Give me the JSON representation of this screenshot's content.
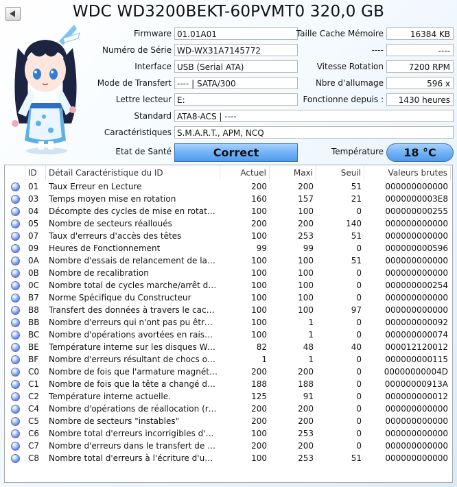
{
  "title": "WDC WD3200BEKT-60PVMT0 320,0 GB",
  "fields": {
    "firmware": {
      "label": "Firmware",
      "value": "01.01A01"
    },
    "serial": {
      "label": "Numéro de Série",
      "value": "WD-WX31A7145772"
    },
    "interface": {
      "label": "Interface",
      "value": "USB (Serial ATA)"
    },
    "transfer": {
      "label": "Mode de Transfert",
      "value": "---- | SATA/300"
    },
    "drive": {
      "label": "Lettre lecteur",
      "value": "E:"
    },
    "standard": {
      "label": "Standard",
      "value": "ATA8-ACS | ----"
    },
    "features": {
      "label": "Caractéristiques",
      "value": "S.M.A.R.T., APM, NCQ"
    },
    "cache": {
      "label": "Taille Cache Mémoire",
      "value": "16384 KB"
    },
    "blank": {
      "label": "----",
      "value": "----"
    },
    "rotation": {
      "label": "Vitesse Rotation",
      "value": "7200 RPM"
    },
    "power_count": {
      "label": "Nbre d'allumage",
      "value": "596 x"
    },
    "power_hours": {
      "label": "Fonctionne depuis :",
      "value": "1430 heures"
    }
  },
  "health": {
    "label": "Etat de Santé",
    "value": "Correct"
  },
  "temperature": {
    "label": "Température",
    "value": "18 °C"
  },
  "table": {
    "headers": {
      "id": "ID",
      "name": "Détail Caractéristique du ID",
      "current": "Actuel",
      "worst": "Maxi",
      "threshold": "Seuil",
      "raw": "Valeurs brutes"
    },
    "rows": [
      {
        "id": "01",
        "name": "Taux Erreur en Lecture",
        "current": "200",
        "worst": "200",
        "threshold": "51",
        "raw": "000000000000"
      },
      {
        "id": "03",
        "name": "Temps moyen mise en rotation",
        "current": "160",
        "worst": "157",
        "threshold": "21",
        "raw": "0000000003E8"
      },
      {
        "id": "04",
        "name": "Décompte des cycles de mise en rotation",
        "current": "100",
        "worst": "100",
        "threshold": "0",
        "raw": "000000000255"
      },
      {
        "id": "05",
        "name": "Nombre de secteurs réalloués",
        "current": "200",
        "worst": "200",
        "threshold": "140",
        "raw": "000000000000"
      },
      {
        "id": "07",
        "name": "Taux d'erreurs d'accès des têtes",
        "current": "100",
        "worst": "253",
        "threshold": "51",
        "raw": "000000000000"
      },
      {
        "id": "09",
        "name": "Heures de Fonctionnement",
        "current": "99",
        "worst": "99",
        "threshold": "0",
        "raw": "000000000596"
      },
      {
        "id": "0A",
        "name": "Nombre d'essais de relancement de la r...",
        "current": "100",
        "worst": "100",
        "threshold": "51",
        "raw": "000000000000"
      },
      {
        "id": "0B",
        "name": "Nombre de recalibration",
        "current": "100",
        "worst": "100",
        "threshold": "0",
        "raw": "000000000000"
      },
      {
        "id": "0C",
        "name": "Nombre total de cycles marche/arrêt du ...",
        "current": "100",
        "worst": "100",
        "threshold": "0",
        "raw": "000000000254"
      },
      {
        "id": "B7",
        "name": "Norme Spécifique du Constructeur",
        "current": "100",
        "worst": "100",
        "threshold": "0",
        "raw": "000000000000"
      },
      {
        "id": "B8",
        "name": "Transfert des données à travers le cache...",
        "current": "100",
        "worst": "100",
        "threshold": "97",
        "raw": "000000000000"
      },
      {
        "id": "BB",
        "name": "Nombre d'erreurs qui n'ont pas pu être r...",
        "current": "100",
        "worst": "1",
        "threshold": "0",
        "raw": "000000000092"
      },
      {
        "id": "BC",
        "name": "Nombre d'opérations avortées en raison ...",
        "current": "100",
        "worst": "1",
        "threshold": "0",
        "raw": "000000000074"
      },
      {
        "id": "BE",
        "name": "Température interne sur les disques We...",
        "current": "82",
        "worst": "48",
        "threshold": "40",
        "raw": "000012120012"
      },
      {
        "id": "BF",
        "name": "Nombre d'erreurs résultant de chocs ou ...",
        "current": "1",
        "worst": "1",
        "threshold": "0",
        "raw": "000000000115"
      },
      {
        "id": "C0",
        "name": "Nombre de fois que l'armature magnétiq...",
        "current": "200",
        "worst": "200",
        "threshold": "0",
        "raw": "00000000004D"
      },
      {
        "id": "C1",
        "name": "Nombre de fois que la tête a changé de ...",
        "current": "188",
        "worst": "188",
        "threshold": "0",
        "raw": "00000000913A"
      },
      {
        "id": "C2",
        "name": "Température interne actuelle.",
        "current": "125",
        "worst": "91",
        "threshold": "0",
        "raw": "000000000012"
      },
      {
        "id": "C4",
        "name": "Nombre d'opérations de réallocation (re...",
        "current": "200",
        "worst": "200",
        "threshold": "0",
        "raw": "000000000000"
      },
      {
        "id": "C5",
        "name": "Nombre de secteurs \"instables\"",
        "current": "200",
        "worst": "200",
        "threshold": "0",
        "raw": "000000000000"
      },
      {
        "id": "C6",
        "name": "Nombre total d'erreurs incorrigibles d'un ...",
        "current": "100",
        "worst": "253",
        "threshold": "0",
        "raw": "000000000000"
      },
      {
        "id": "C7",
        "name": "Nombre d'erreurs dans le transfert de do...",
        "current": "200",
        "worst": "200",
        "threshold": "0",
        "raw": "000000000000"
      },
      {
        "id": "C8",
        "name": "Nombre total d'erreurs à l'écriture d'un s...",
        "current": "100",
        "worst": "253",
        "threshold": "51",
        "raw": "000000000000"
      }
    ]
  }
}
